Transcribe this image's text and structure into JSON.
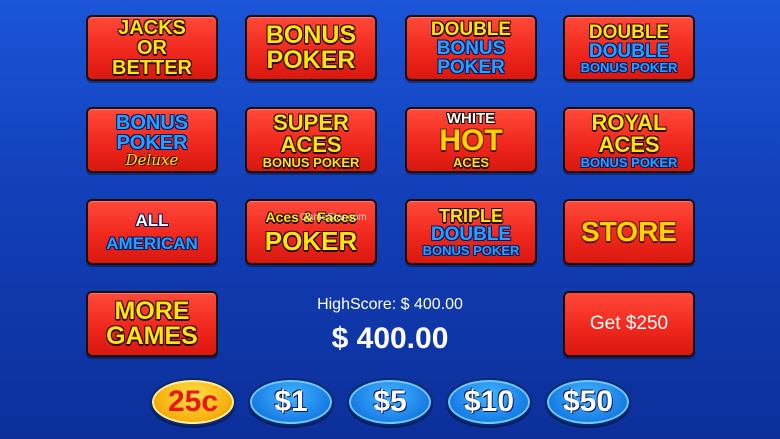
{
  "games": {
    "jacks_or_better": [
      "JACKS",
      "OR",
      "BETTER"
    ],
    "bonus_poker": [
      "BONUS",
      "POKER"
    ],
    "double_bonus_poker": [
      "DOUBLE",
      "BONUS",
      "POKER"
    ],
    "double_double_bonus_poker": [
      "DOUBLE",
      "DOUBLE",
      "BONUS POKER"
    ],
    "bonus_poker_deluxe": [
      "BONUS",
      "POKER",
      "Deluxe"
    ],
    "super_aces_bonus_poker": [
      "SUPER",
      "ACES",
      "BONUS POKER"
    ],
    "white_hot_aces": [
      "WHITE",
      "HOT",
      "ACES"
    ],
    "royal_aces_bonus_poker": [
      "ROYAL",
      "ACES",
      "BONUS POKER"
    ],
    "all_american": [
      "ALL",
      "AMERICAN"
    ],
    "aces_and_faces_poker": [
      "Aces & Faces",
      "POKER"
    ],
    "triple_double_bonus_poker": [
      "TRIPLE",
      "DOUBLE",
      "BONUS POKER"
    ],
    "store": [
      "STORE"
    ],
    "more_games": [
      "MORE",
      "GAMES"
    ]
  },
  "get_credits_label": "Get $250",
  "high_score": "HighScore: $ 400.00",
  "credits": "$ 400.00",
  "watermark": "GameStar.com",
  "denominations": [
    "25c",
    "$1",
    "$5",
    "$10",
    "$50"
  ],
  "selected_denomination": "25c",
  "colors": {
    "background": "#1b55d8",
    "button": "#f0281d",
    "yellow_text": "#ffe410",
    "blue_text": "#25a2ff",
    "chip": "#1c82e8",
    "chip_selected": "#f7b210"
  }
}
